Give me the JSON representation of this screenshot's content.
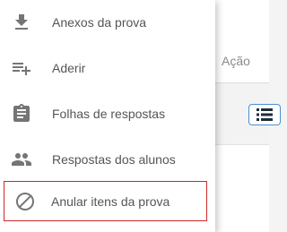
{
  "table": {
    "action_header": "Ação",
    "row_action_icon": "list-icon"
  },
  "menu": {
    "items": [
      {
        "label": "Anexos da prova",
        "icon": "download-icon"
      },
      {
        "label": "Aderir",
        "icon": "playlist-add-icon"
      },
      {
        "label": "Folhas de respostas",
        "icon": "clipboard-icon"
      },
      {
        "label": "Respostas dos alunos",
        "icon": "people-icon"
      },
      {
        "label": "Anular itens da prova",
        "icon": "block-icon",
        "highlighted": true
      }
    ],
    "highlight_color": "#cc2a2a",
    "icon_color": "#757575"
  }
}
